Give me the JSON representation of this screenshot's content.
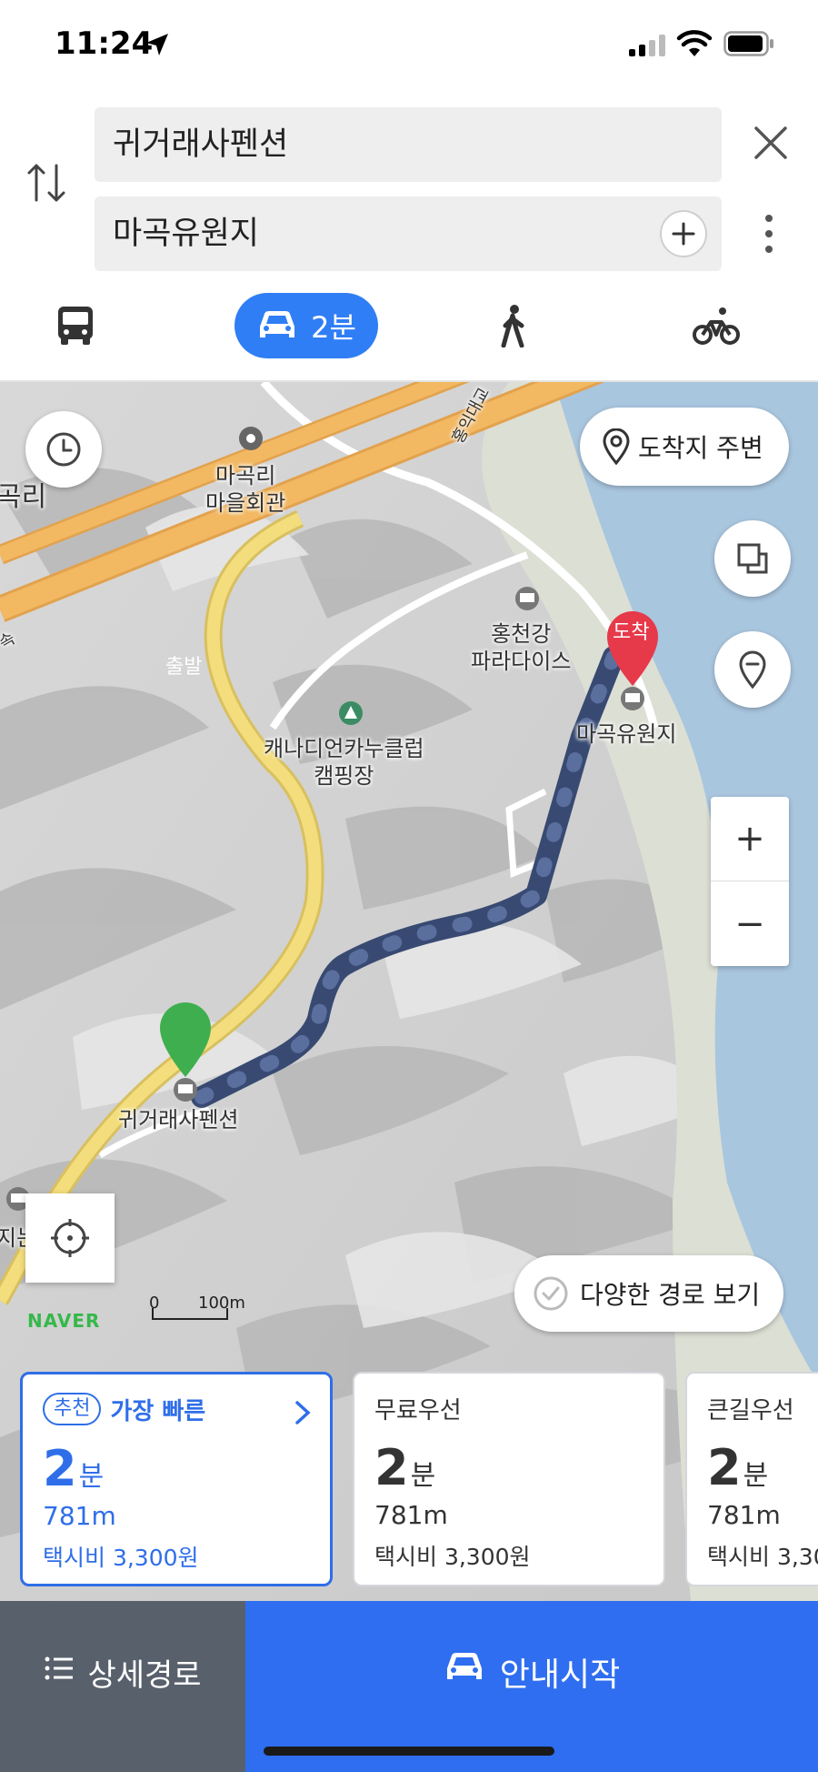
{
  "status": {
    "time": "11:24"
  },
  "search": {
    "origin": "귀거래사펜션",
    "destination": "마곡유원지"
  },
  "modes": {
    "selected": "car",
    "car_time": "2분",
    "icons": [
      "bus-icon",
      "car-icon",
      "walk-icon",
      "bike-icon"
    ]
  },
  "map": {
    "labels": {
      "village_hall": "마곡리\n마을회관",
      "village_edge": "곡리",
      "hongcheon_paradise": "홍천강\n파라다이스",
      "canoe_camp": "캐나디언카누클럽\n캠핑장",
      "destination_place": "마곡유원지",
      "origin_place": "귀거래사펜션",
      "left_edge": "지는",
      "road_label": "홍익대교",
      "road_edge": "속"
    },
    "start_marker": "출발",
    "end_marker": "도착",
    "arrival_area_button": "도착지 주변",
    "various_routes_button": "다양한 경로 보기",
    "zoom_in": "+",
    "zoom_out": "−",
    "logo": "NAVER",
    "scale_zero": "0",
    "scale_label": "100m"
  },
  "routes": [
    {
      "badge": "추천",
      "name": "가장 빠른",
      "time_num": "2",
      "time_unit": "분",
      "distance": "781m",
      "fare": "택시비 3,300원"
    },
    {
      "badge": "",
      "name": "무료우선",
      "time_num": "2",
      "time_unit": "분",
      "distance": "781m",
      "fare": "택시비 3,300원"
    },
    {
      "badge": "",
      "name": "큰길우선",
      "time_num": "2",
      "time_unit": "분",
      "distance": "781m",
      "fare": "택시비 3,30"
    }
  ],
  "bottom": {
    "detail_label": "상세경로",
    "start_label": "안내시작"
  },
  "colors": {
    "accent": "#2f6ef0",
    "route_line": "#4a5b80",
    "start_marker": "#3fae4f",
    "end_marker": "#e6394a"
  }
}
